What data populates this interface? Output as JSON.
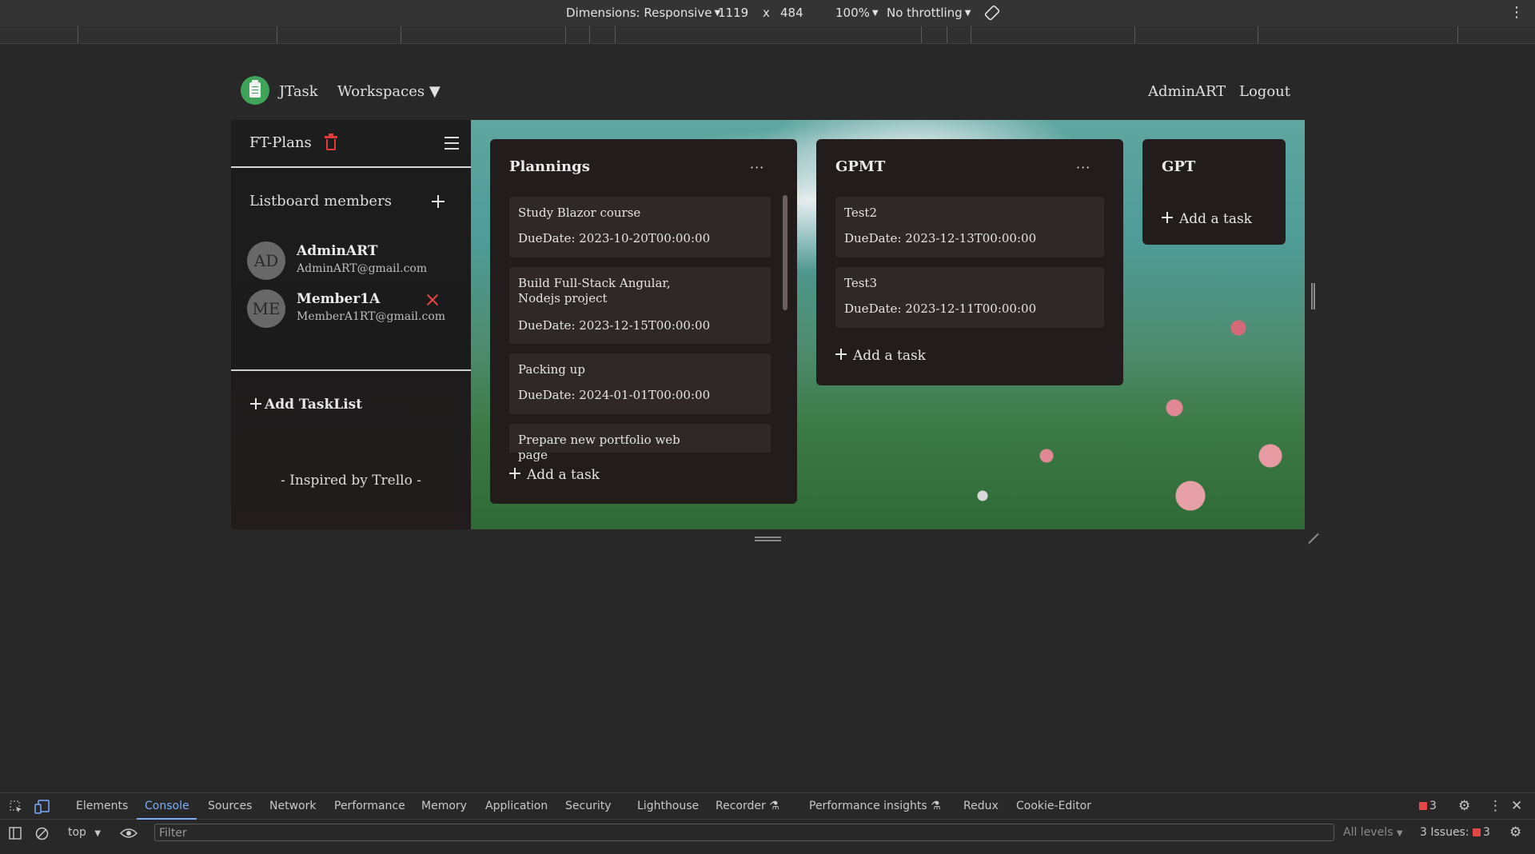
{
  "device_toolbar": {
    "dimensions_label": "Dimensions: Responsive",
    "width_value": "1119",
    "times": "x",
    "height_value": "484",
    "zoom": "100%",
    "throttling": "No throttling"
  },
  "app": {
    "brand": "JTask",
    "workspaces_label": "Workspaces",
    "workspaces_caret": "▼",
    "username": "AdminART",
    "logout_label": "Logout",
    "sidebar": {
      "board_name": "FT-Plans",
      "members_label": "Listboard members",
      "members": [
        {
          "initials": "AD",
          "name": "AdminART",
          "email": "AdminART@gmail.com"
        },
        {
          "initials": "ME",
          "name": "Member1A",
          "email": "MemberA1RT@gmail.com"
        }
      ],
      "add_tasklist_label": "Add TaskList",
      "footer": "- Inspired by Trello -"
    },
    "lists": [
      {
        "title": "Plannings",
        "menu": "···",
        "cards": [
          {
            "title": "Study Blazor course",
            "due": "DueDate: 2023-10-20T00:00:00"
          },
          {
            "title": "Build Full-Stack Angular, Nodejs project",
            "due": "DueDate: 2023-12-15T00:00:00"
          },
          {
            "title": "Packing up",
            "due": "DueDate: 2024-01-01T00:00:00"
          },
          {
            "title": "Prepare new portfolio web page",
            "due": ""
          }
        ],
        "add_task_label": "Add a task"
      },
      {
        "title": "GPMT",
        "menu": "···",
        "cards": [
          {
            "title": "Test2",
            "due": "DueDate: 2023-12-13T00:00:00"
          },
          {
            "title": "Test3",
            "due": "DueDate: 2023-12-11T00:00:00"
          }
        ],
        "add_task_label": "Add a task"
      },
      {
        "title": "GPT",
        "cards": [],
        "add_task_label": "Add a task"
      }
    ]
  },
  "devtools": {
    "tabs": [
      "Elements",
      "Console",
      "Sources",
      "Network",
      "Performance",
      "Memory",
      "Application",
      "Security",
      "Lighthouse",
      "Recorder",
      "Performance insights",
      "Redux",
      "Cookie-Editor"
    ],
    "active_tab": "Console",
    "issues_count_top": "3",
    "context": "top",
    "filter_placeholder": "Filter",
    "levels": "All levels",
    "issues_label": "3 Issues:",
    "issues_count": "3"
  },
  "colors": {
    "accent_green": "#3fa35a",
    "danger_red": "#e03a3a",
    "devtools_active": "#7cacf8",
    "list_bg": "#221c1c",
    "card_bg": "#302828"
  }
}
